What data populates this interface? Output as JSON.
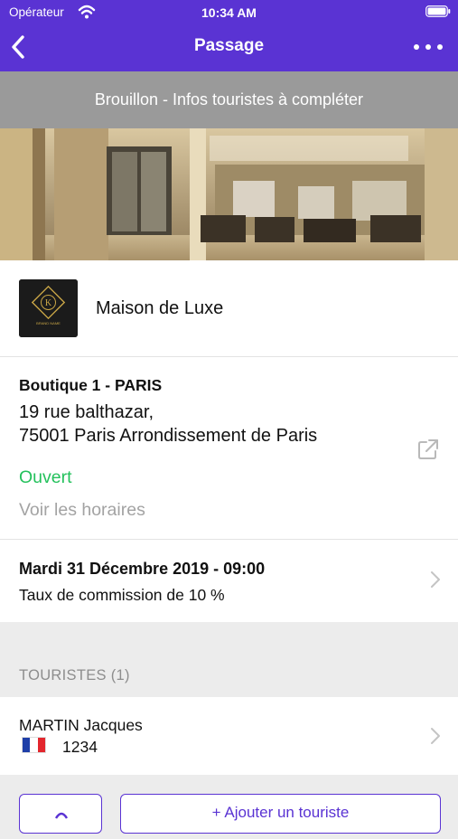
{
  "status_bar": {
    "carrier": "Opérateur",
    "time": "10:34 AM"
  },
  "nav": {
    "title": "Passage"
  },
  "banner": {
    "text": "Brouillon - Infos touristes à compléter"
  },
  "brand": {
    "name": "Maison de Luxe",
    "logo_text": "BRAND NAME",
    "logo_letter": "K"
  },
  "store": {
    "name": "Boutique 1 - PARIS",
    "address_line1": "19 rue balthazar,",
    "address_line2": "75001 Paris Arrondissement de Paris",
    "status": "Ouvert",
    "hours_link": "Voir les horaires"
  },
  "visit": {
    "date": "Mardi 31 Décembre 2019 - 09:00",
    "commission": "Taux de commission de 10 %"
  },
  "tourists": {
    "section_title": "TOURISTES (1)",
    "items": [
      {
        "name": "MARTIN Jacques",
        "flag": "france-flag-icon",
        "passport": "1234"
      }
    ]
  },
  "actions": {
    "add_label": "+ Ajouter un touriste"
  },
  "colors": {
    "primary": "#5a33d3",
    "open_green": "#24c15c",
    "banner_gray": "#9a9a9a"
  }
}
